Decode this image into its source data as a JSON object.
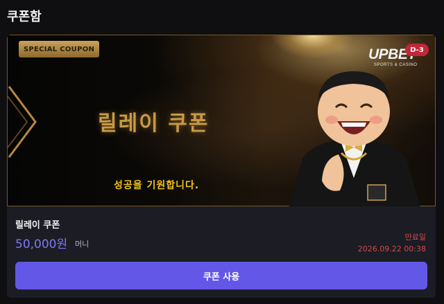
{
  "page": {
    "title": "쿠폰함"
  },
  "coupon": {
    "badge": "SPECIAL COUPON",
    "banner_title": "릴레이 쿠폰",
    "banner_subtitle": "성공을 기원합니다.",
    "logo_main": "UPBET",
    "logo_sub": "SPORTS & CASINO",
    "dday": "D-3",
    "name": "릴레이 쿠폰",
    "amount": "50,000원",
    "amount_unit": "머니",
    "expiry_label": "만료일",
    "expiry_date": "2026.09.22 00:38",
    "use_button": "쿠폰 사용",
    "colors": {
      "accent": "#6357e8",
      "amount": "#7e78f5",
      "expiry": "#d04b4b",
      "gold": "#c99a45",
      "subtitle": "#f0c419"
    }
  }
}
